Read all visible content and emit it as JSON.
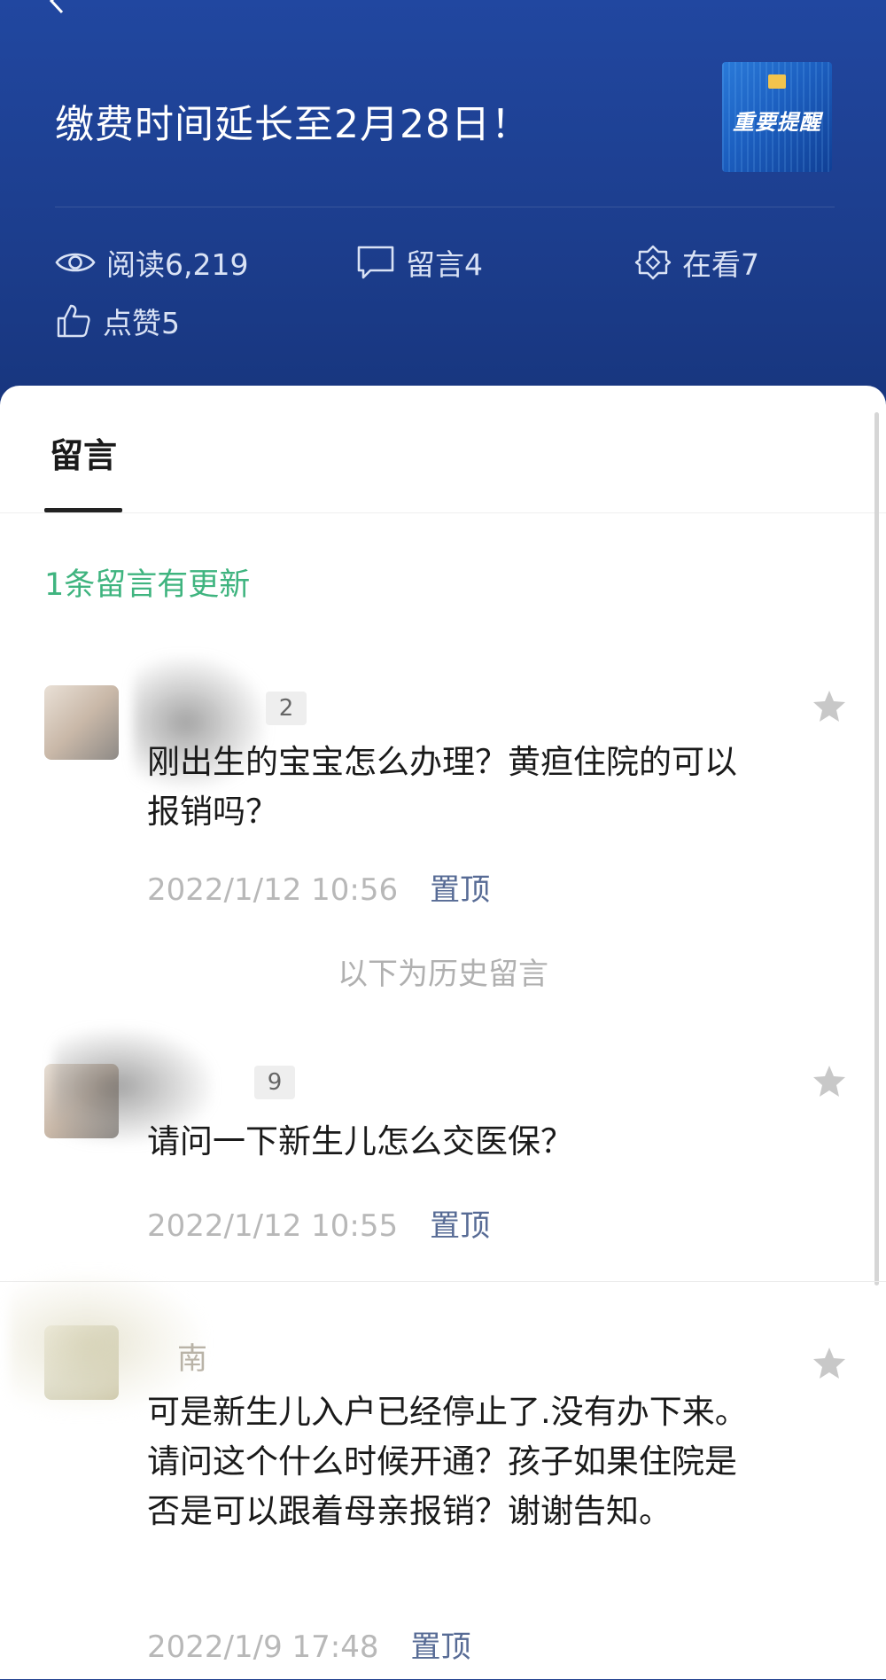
{
  "header": {
    "title": "缴费时间延长至2月28日！",
    "thumbnail_text": "重要提醒"
  },
  "stats": {
    "reads": "阅读6,219",
    "comments": "留言4",
    "watching": "在看7",
    "likes": "点赞5"
  },
  "comments_panel": {
    "tab_label": "留言",
    "update_notice": "1条留言有更新",
    "history_separator": "以下为历史留言",
    "pin_label": "置顶",
    "items": [
      {
        "badge": "2",
        "name": "",
        "text": "刚出生的宝宝怎么办理？黄疸住院的可以报销吗？",
        "time": "2022/1/12 10:56"
      },
      {
        "badge": "9",
        "name": "",
        "text": "请问一下新生儿怎么交医保？",
        "time": "2022/1/12 10:55"
      },
      {
        "badge": "",
        "name": "南",
        "text": "可是新生儿入户已经停止了.没有办下来。请问这个什么时候开通？孩子如果住院是否是可以跟着母亲报销？谢谢告知。",
        "time": "2022/1/9 17:48"
      }
    ]
  },
  "colors": {
    "header_bg": "#1f3f8e",
    "notice_green": "#3fb47f",
    "link_blue": "#576b95"
  }
}
